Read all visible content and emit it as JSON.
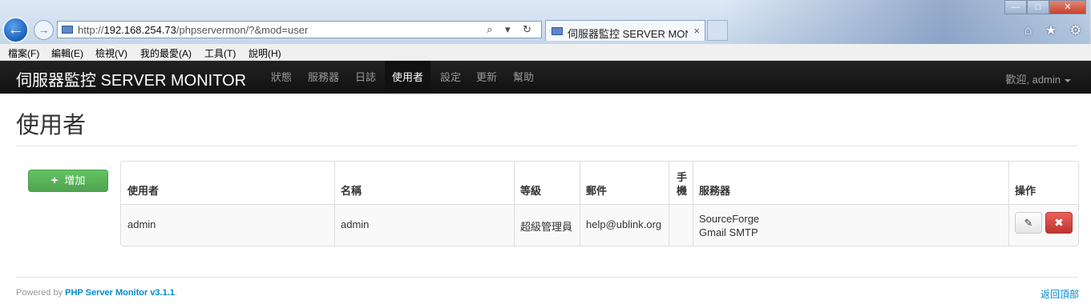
{
  "browser": {
    "url_prefix": "http://",
    "url_host": "192.168.254.73",
    "url_path": "/phpservermon/?&mod=user",
    "tab_title": "伺服器監控 SERVER MONI...",
    "tab_close": "×",
    "address_tools": "⌕ ▾ ↻",
    "right_icons": "⌂ ★ ⚙",
    "win_min": "—",
    "win_max": "□",
    "win_close": "✕"
  },
  "menubar": {
    "items": [
      "檔案(F)",
      "編輯(E)",
      "檢視(V)",
      "我的最愛(A)",
      "工具(T)",
      "說明(H)"
    ]
  },
  "navbar": {
    "brand": "伺服器監控 SERVER MONITOR",
    "items": [
      "狀態",
      "服務器",
      "日誌",
      "使用者",
      "設定",
      "更新",
      "幫助"
    ],
    "active": "使用者",
    "welcome": "歡迎, admin"
  },
  "page": {
    "title": "使用者",
    "add_button": "增加"
  },
  "table": {
    "headers": [
      "使用者",
      "名稱",
      "等級",
      "郵件",
      "手\n機",
      "服務器",
      "操作"
    ],
    "rows": [
      {
        "user": "admin",
        "name": "admin",
        "level": "超級管理員",
        "email": "help@ublink.org",
        "mobile": "",
        "servers": [
          "SourceForge",
          "Gmail SMTP"
        ]
      }
    ]
  },
  "footer": {
    "powered_by": "Powered by",
    "product": "PHP Server Monitor v3.1.1",
    "period": ".",
    "back_to_top": "返回頂部"
  },
  "colors": {
    "navbar_bg": "#1b1b1b",
    "add_button": "#5bb75b",
    "delete_button": "#da4f49",
    "link": "#0088cc"
  }
}
